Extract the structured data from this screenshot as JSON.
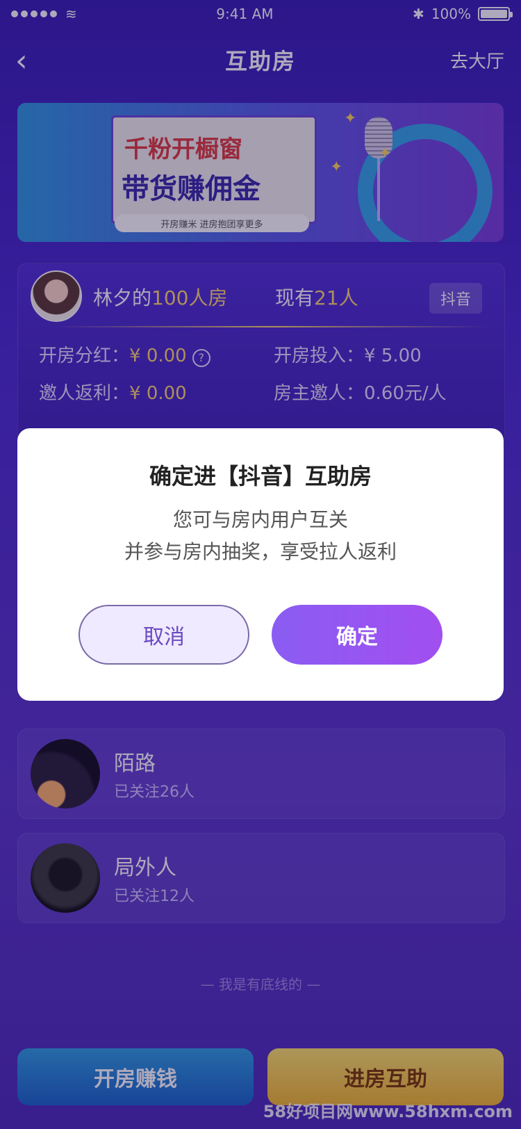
{
  "status_bar": {
    "time": "9:41 AM",
    "battery": "100%"
  },
  "nav": {
    "back_icon": "chevron-left-icon",
    "title": "互助房",
    "right_link": "去大厅"
  },
  "banner": {
    "line1": "千粉开橱窗",
    "line2": "带货赚佣金",
    "sub": "开房赚米  进房抱团享更多"
  },
  "room": {
    "owner_name": "林夕的",
    "capacity": "100人房",
    "count_prefix": "现有",
    "count_value": "21人",
    "platform": "抖音",
    "stats": {
      "dividend_label": "开房分红：",
      "dividend_value": "¥ 0.00",
      "investment_label": "开房投入：",
      "investment_value": "¥ 5.00",
      "invite_rebate_label": "邀人返利：",
      "invite_rebate_value": "¥ 0.00",
      "owner_invite_label": "房主邀人：",
      "owner_invite_value": "0.60元/人"
    }
  },
  "users": [
    {
      "name": "陌路",
      "follow": "已关注26人"
    },
    {
      "name": "局外人",
      "follow": "已关注12人"
    }
  ],
  "footer_note": "— 我是有底线的 —",
  "bottom": {
    "open_room": "开房赚钱",
    "enter_room": "进房互助"
  },
  "watermark": "58好项目网www.58hxm.com",
  "dialog": {
    "title": "确定进【抖音】互助房",
    "line1": "您可与房内用户互关",
    "line2": "并参与房内抽奖，享受拉人返利",
    "cancel": "取消",
    "confirm": "确定"
  }
}
